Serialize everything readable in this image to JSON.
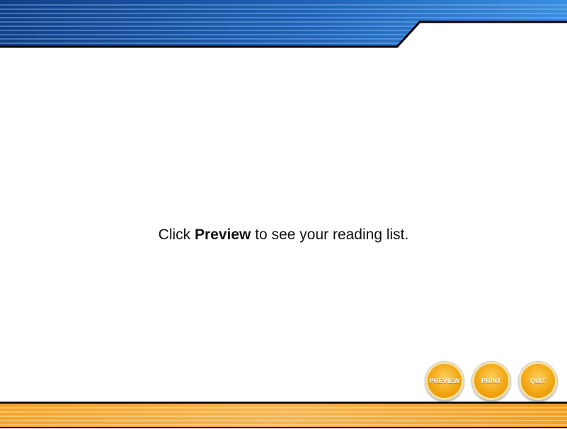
{
  "message": {
    "prefix": "Click ",
    "bold": "Preview",
    "suffix": " to see your reading list."
  },
  "buttons": {
    "preview": "PREVIEW",
    "print": "PRINT",
    "quit": "QUIT"
  },
  "colors": {
    "header_blue": "#1f63b8",
    "footer_orange": "#f7a52a",
    "button_gold": "#f3a714"
  }
}
